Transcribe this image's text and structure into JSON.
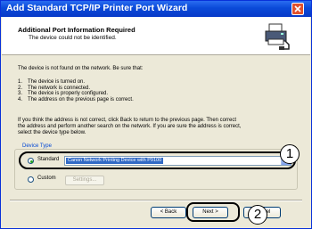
{
  "window": {
    "title": "Add Standard TCP/IP Printer Port Wizard",
    "close_icon": "close-x-icon"
  },
  "header": {
    "title": "Additional Port Information Required",
    "subtitle": "The device could not be identified.",
    "icon": "printer-port-icon"
  },
  "body": {
    "intro": "The device is not found on the network.  Be sure that:",
    "checklist": [
      {
        "num": "1.",
        "text": "The device is turned on."
      },
      {
        "num": "2.",
        "text": "The network is connected."
      },
      {
        "num": "3.",
        "text": "The device is properly configured."
      },
      {
        "num": "4.",
        "text": "The address on the previous page is correct."
      }
    ],
    "advice_lines": [
      "If you think the address is not correct, click Back to return to the previous page.  Then correct",
      "the address and perform another search on the network.  If you are sure the address is correct,",
      "select the device type below."
    ]
  },
  "device_type": {
    "legend": "Device Type",
    "standard_label": "Standard",
    "standard_selected": true,
    "standard_value": "Canon Network Printing Device with P9100",
    "custom_label": "Custom",
    "custom_selected": false,
    "settings_label": "Settings..."
  },
  "buttons": {
    "back": "< Back",
    "next": "Next >",
    "cancel": "Cancel"
  },
  "callouts": {
    "one": "1",
    "two": "2"
  },
  "colors": {
    "titlebar": "#0a4ad8",
    "window_bg": "#ece9d8",
    "selection": "#316ac5",
    "legend": "#0046d5"
  }
}
